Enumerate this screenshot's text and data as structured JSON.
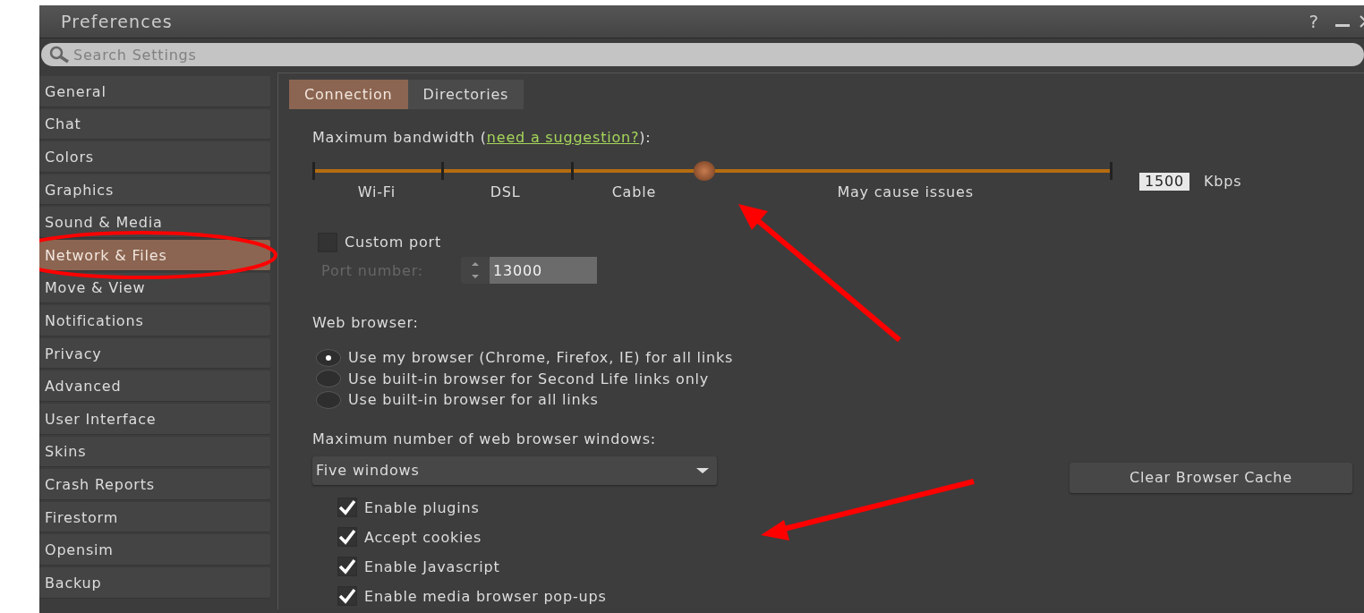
{
  "window": {
    "title": "Preferences",
    "help": "?"
  },
  "search": {
    "placeholder": "Search Settings"
  },
  "sidebar": {
    "items": [
      {
        "label": "General",
        "selected": false
      },
      {
        "label": "Chat",
        "selected": false
      },
      {
        "label": "Colors",
        "selected": false
      },
      {
        "label": "Graphics",
        "selected": false
      },
      {
        "label": "Sound & Media",
        "selected": false
      },
      {
        "label": "Network & Files",
        "selected": true
      },
      {
        "label": "Move & View",
        "selected": false
      },
      {
        "label": "Notifications",
        "selected": false
      },
      {
        "label": "Privacy",
        "selected": false
      },
      {
        "label": "Advanced",
        "selected": false
      },
      {
        "label": "User Interface",
        "selected": false
      },
      {
        "label": "Skins",
        "selected": false
      },
      {
        "label": "Crash Reports",
        "selected": false
      },
      {
        "label": "Firestorm",
        "selected": false
      },
      {
        "label": "Opensim",
        "selected": false
      },
      {
        "label": "Backup",
        "selected": false
      }
    ]
  },
  "tabs": [
    {
      "label": "Connection",
      "selected": true
    },
    {
      "label": "Directories",
      "selected": false
    }
  ],
  "bandwidth": {
    "label": "Maximum bandwidth (",
    "link": "need a suggestion?",
    "label_end": "):",
    "level": 0.49,
    "marks": [
      "Wi-Fi",
      "DSL",
      "Cable",
      "May cause issues"
    ],
    "value": "1500",
    "unit": "Kbps"
  },
  "custom_port": {
    "label": "Custom port",
    "checked": false
  },
  "port": {
    "label": "Port number:",
    "value": "13000",
    "disabled": true
  },
  "web_browser": {
    "label": "Web browser:",
    "options": [
      {
        "label": "Use my browser (Chrome, Firefox, IE) for all links",
        "selected": true
      },
      {
        "label": "Use built-in browser for Second Life links only",
        "selected": false
      },
      {
        "label": "Use built-in browser for all links",
        "selected": false
      }
    ]
  },
  "max_windows": {
    "label": "Maximum number of web browser windows:",
    "value": "Five windows"
  },
  "clear_cache_button": "Clear Browser Cache",
  "checkboxes": [
    {
      "label": "Enable plugins",
      "checked": true
    },
    {
      "label": "Accept cookies",
      "checked": true
    },
    {
      "label": "Enable Javascript",
      "checked": true
    },
    {
      "label": "Enable media browser pop-ups",
      "checked": true
    }
  ]
}
